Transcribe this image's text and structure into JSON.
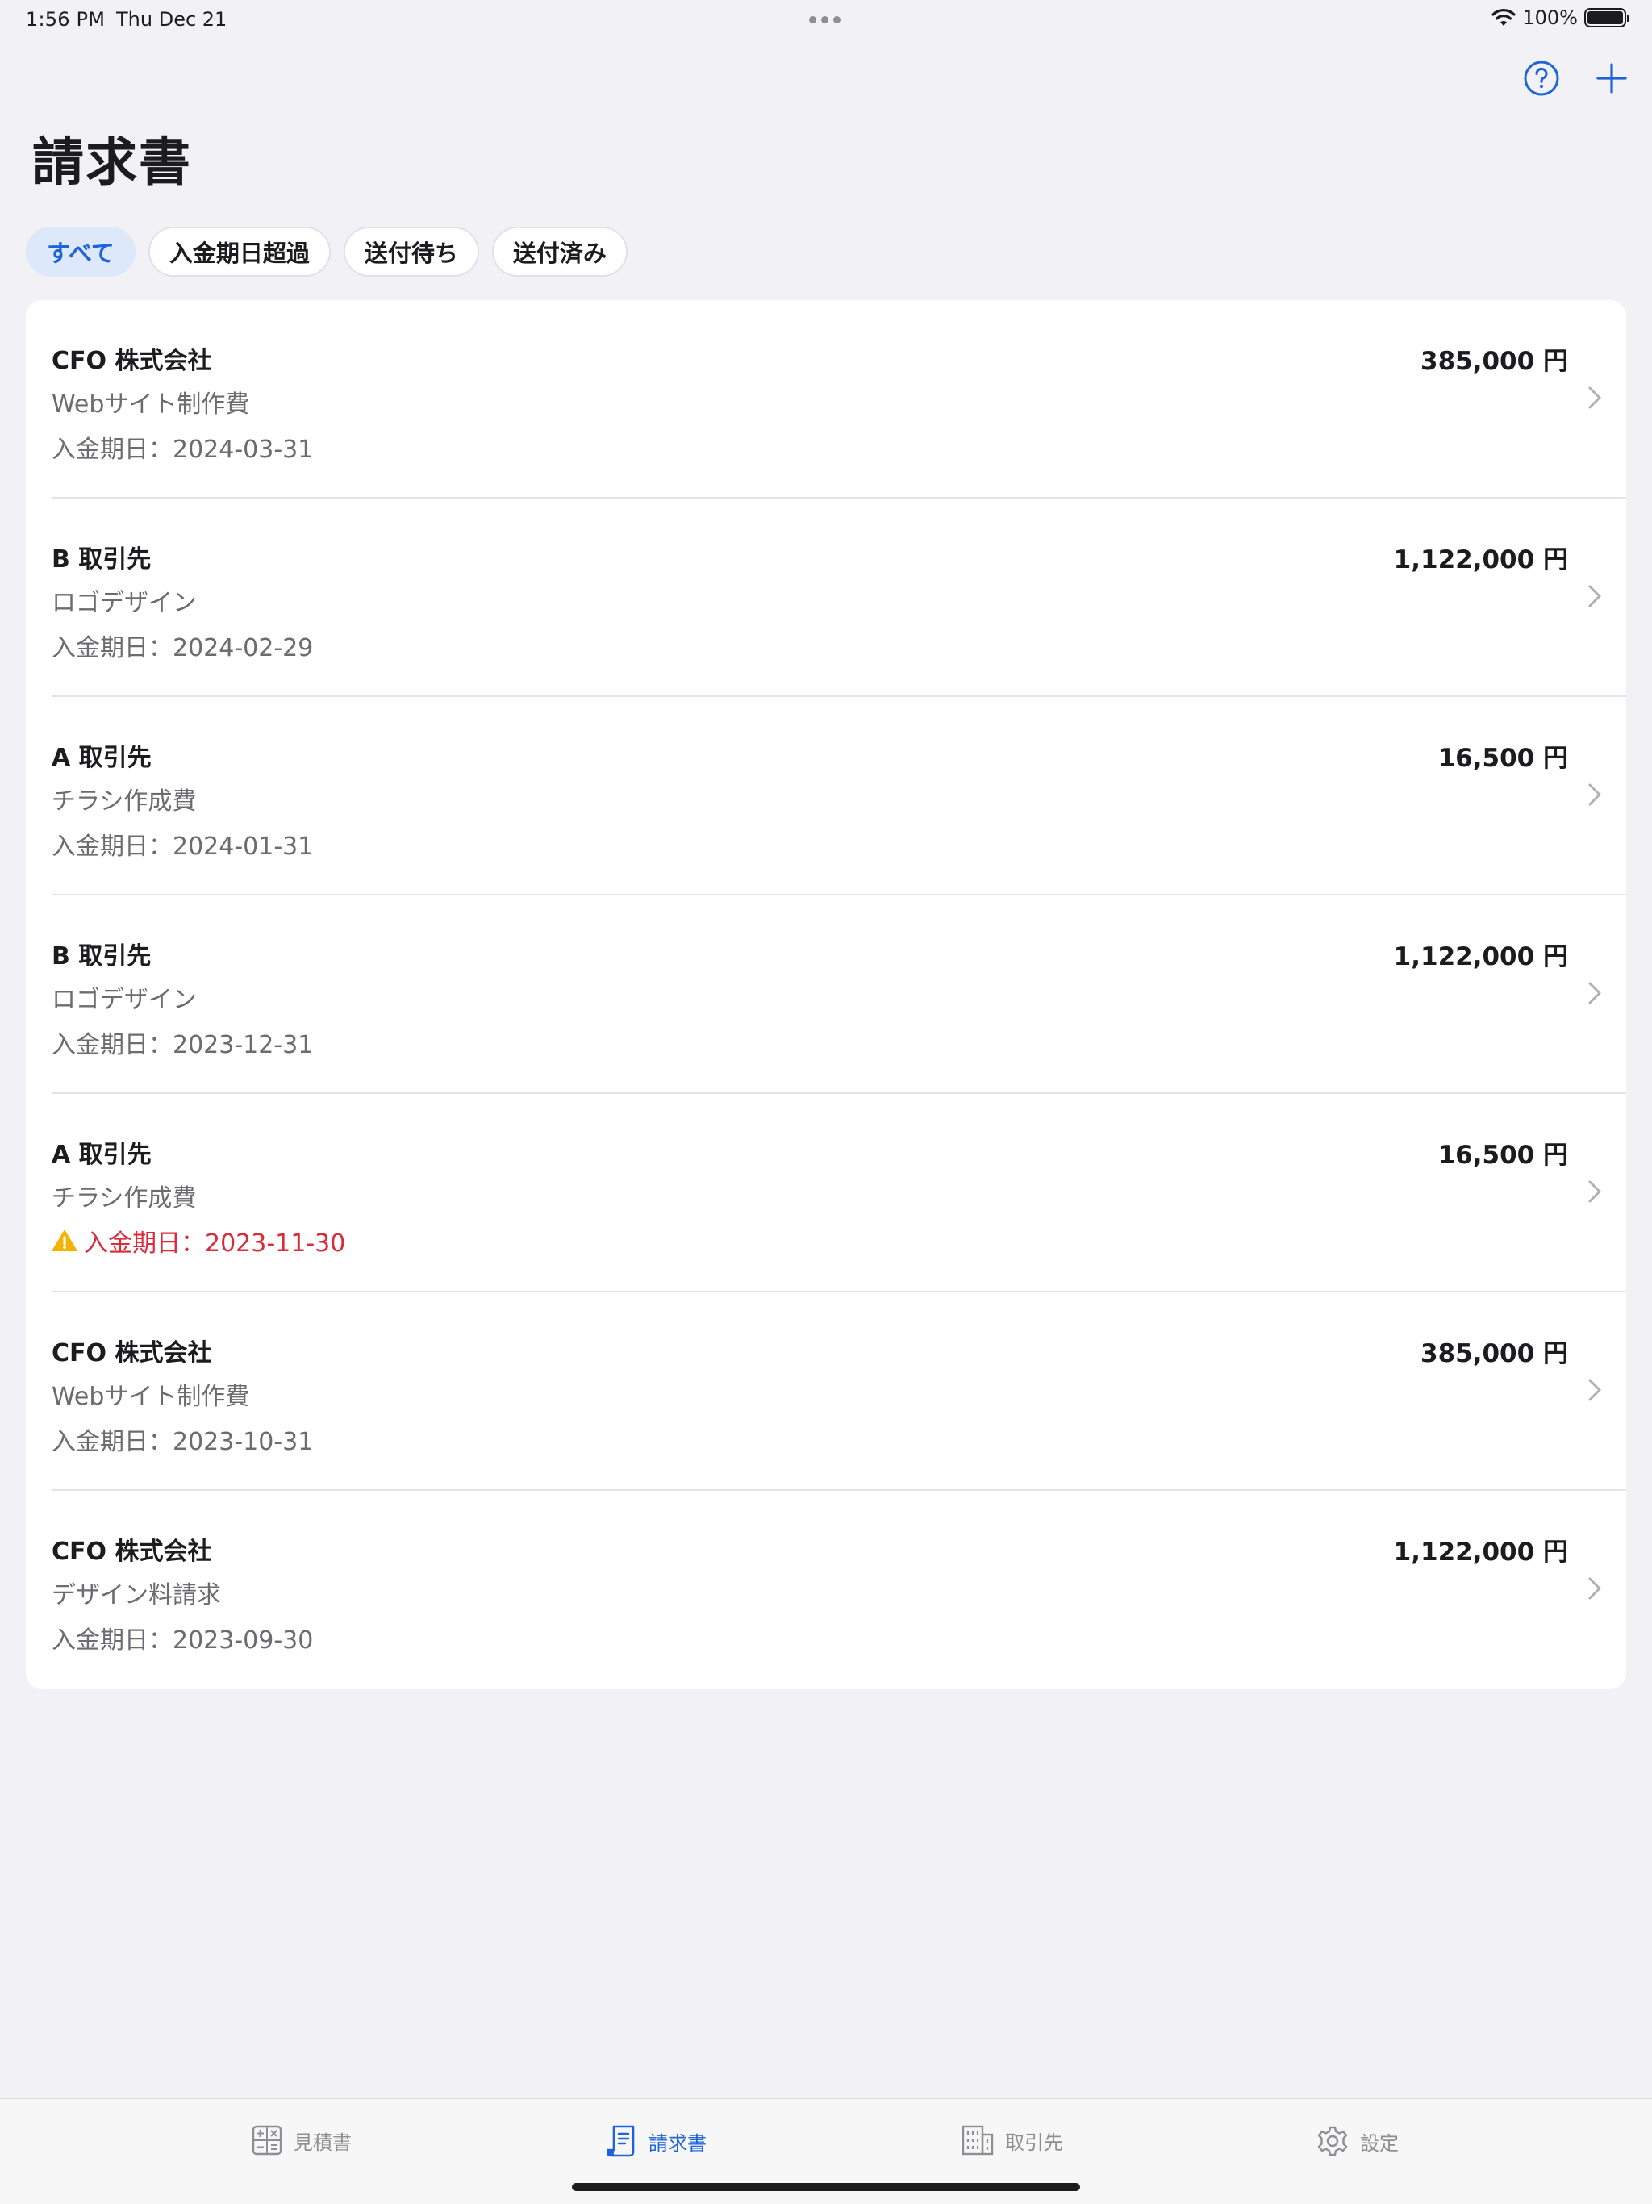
{
  "status_bar": {
    "time": "1:56 PM",
    "date": "Thu Dec 21",
    "battery": "100%"
  },
  "nav": {
    "title": "請求書",
    "help_icon": "question-circle-icon",
    "add_icon": "plus-icon"
  },
  "filters": [
    {
      "label": "すべて",
      "active": true
    },
    {
      "label": "入金期日超過",
      "active": false
    },
    {
      "label": "送付待ち",
      "active": false
    },
    {
      "label": "送付済み",
      "active": false
    }
  ],
  "invoices": [
    {
      "client": "CFO 株式会社",
      "subject": "Webサイト制作費",
      "due": "入金期日：2024-03-31",
      "amount": "385,000 円",
      "overdue": false
    },
    {
      "client": "B 取引先",
      "subject": "ロゴデザイン",
      "due": "入金期日：2024-02-29",
      "amount": "1,122,000 円",
      "overdue": false
    },
    {
      "client": "A 取引先",
      "subject": "チラシ作成費",
      "due": "入金期日：2024-01-31",
      "amount": "16,500 円",
      "overdue": false
    },
    {
      "client": "B 取引先",
      "subject": "ロゴデザイン",
      "due": "入金期日：2023-12-31",
      "amount": "1,122,000 円",
      "overdue": false
    },
    {
      "client": "A 取引先",
      "subject": "チラシ作成費",
      "due": "入金期日：2023-11-30",
      "amount": "16,500 円",
      "overdue": true
    },
    {
      "client": "CFO 株式会社",
      "subject": "Webサイト制作費",
      "due": "入金期日：2023-10-31",
      "amount": "385,000 円",
      "overdue": false
    },
    {
      "client": "CFO 株式会社",
      "subject": "デザイン料請求",
      "due": "入金期日：2023-09-30",
      "amount": "1,122,000 円",
      "overdue": false
    }
  ],
  "tabs": [
    {
      "label": "見積書",
      "icon": "calculator-icon",
      "active": false
    },
    {
      "label": "請求書",
      "icon": "invoice-icon",
      "active": true
    },
    {
      "label": "取引先",
      "icon": "building-icon",
      "active": false
    },
    {
      "label": "設定",
      "icon": "gear-icon",
      "active": false
    }
  ],
  "colors": {
    "accent": "#1e63d8",
    "overdue": "#d92b3a",
    "warning": "#f5b301",
    "background": "#f2f1f6"
  }
}
